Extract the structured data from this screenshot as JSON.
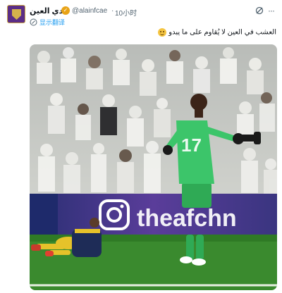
{
  "header": {
    "display_name": "نادي العين",
    "handle": "@alainfcae",
    "separator": "·",
    "time": "10小时",
    "verified_color": "#e8a317",
    "avatar_icon": "al-ain-club-crest-icon",
    "ai_icon": "grok-icon",
    "more_icon": "more-options-icon"
  },
  "translate": {
    "icon": "edit-translate-icon",
    "label": "显示翻译"
  },
  "tweet": {
    "text": "العشب في العين لا يُقاوم على ما يبدو",
    "emoji": "smiling-face-emoji"
  },
  "media": {
    "board_text": "theafchn",
    "jersey_number": "17",
    "ad_icon": "instagram-icon",
    "pitch_color": "#3a8a2e",
    "keeper_kit_color": "#2faa55"
  }
}
